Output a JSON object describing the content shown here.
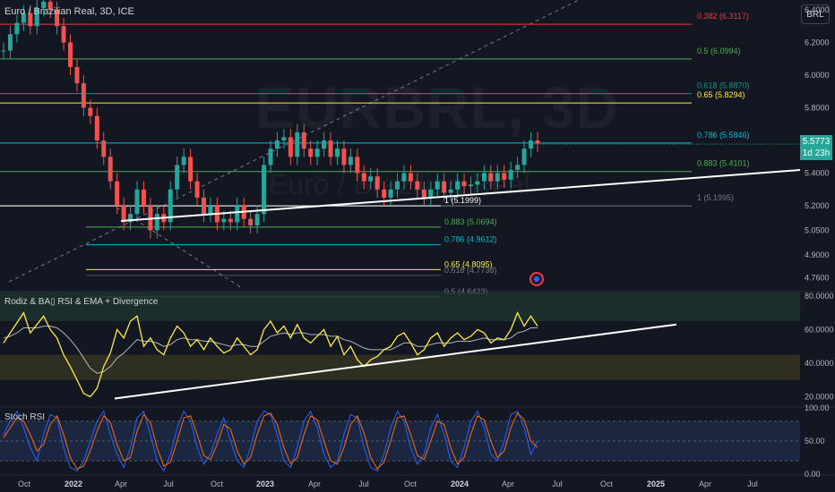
{
  "header": {
    "title": "Euro / Brazilian Real, 3D, ICE",
    "currency_button": "BRL",
    "watermark_symbol": "EURBRL, 3D",
    "watermark_name": "Euro / Brazilian Real"
  },
  "price_tag": {
    "value": "5.5773",
    "countdown": "1d 23h",
    "color": "#26a69a"
  },
  "chart_data": [
    {
      "type": "line",
      "pane": "price",
      "title": "Euro / Brazilian Real, 3D, ICE",
      "ylim": [
        4.68,
        6.46
      ],
      "y_ticks": [
        {
          "value": 6.4,
          "label": "6.4000"
        },
        {
          "value": 6.2,
          "label": "6.2000"
        },
        {
          "value": 6.0,
          "label": "6.0000"
        },
        {
          "value": 5.8,
          "label": "5.8000"
        },
        {
          "value": 5.6,
          "label": "5.6000"
        },
        {
          "value": 5.4,
          "label": "5.4000"
        },
        {
          "value": 5.2,
          "label": "5.2000"
        },
        {
          "value": 5.05,
          "label": "5.0500"
        },
        {
          "value": 4.9,
          "label": "4.9000"
        },
        {
          "value": 4.76,
          "label": "4.7600"
        }
      ],
      "x_ticks": [
        "Oct",
        "2022",
        "Apr",
        "Jul",
        "Oct",
        "2023",
        "Apr",
        "Jul",
        "Oct",
        "2024",
        "Apr",
        "Jul",
        "Oct",
        "2025",
        "Apr",
        "Jul"
      ],
      "fib_upper": [
        {
          "label": "0.382 (6.3117)",
          "value": 6.3117,
          "color": "#f23645"
        },
        {
          "label": "0.5 (6.0994)",
          "value": 6.0994,
          "color": "#4caf50"
        },
        {
          "label": "0.618 (5.8870)",
          "value": 5.887,
          "color": "#089981"
        },
        {
          "label": "0.65 (5.8294)",
          "value": 5.8294,
          "color": "#ffeb3b"
        },
        {
          "label": "0.786 (5.5846)",
          "value": 5.5846,
          "color": "#00bcd4"
        },
        {
          "label": "0.883 (5.4101)",
          "value": 5.4101,
          "color": "#4caf50"
        },
        {
          "label": "1 (5.1995)",
          "value": 5.1995,
          "color": "#787b86"
        }
      ],
      "fib_lower": [
        {
          "label": "1 (5.1999)",
          "value": 5.1999,
          "color": "#ffffff"
        },
        {
          "label": "0.883 (5.0694)",
          "value": 5.0694,
          "color": "#4caf50"
        },
        {
          "label": "0.786 (4.9612)",
          "value": 4.9612,
          "color": "#00bcd4"
        },
        {
          "label": "0.65 (4.8095)",
          "value": 4.8095,
          "color": "#ffeb3b"
        },
        {
          "label": "0.618 (4.7738)",
          "value": 4.7738,
          "color": "#787b86"
        },
        {
          "label": "0.5 (4.6423)",
          "value": 4.6423,
          "color": "#787b86"
        }
      ],
      "series": [
        {
          "close": [
            6.15,
            6.25,
            6.32,
            6.38,
            6.3,
            6.41,
            6.45,
            6.4,
            6.3,
            6.2,
            6.05,
            5.95,
            5.8,
            5.75,
            5.6,
            5.5,
            5.35,
            5.2,
            5.1,
            5.15,
            5.3,
            5.2,
            5.05,
            5.15,
            5.1,
            5.3,
            5.45,
            5.5,
            5.35,
            5.25,
            5.15,
            5.2,
            5.1,
            5.12,
            5.1,
            5.2,
            5.12,
            5.08,
            5.15,
            5.45,
            5.55,
            5.6,
            5.62,
            5.5,
            5.65,
            5.55,
            5.5,
            5.55,
            5.6,
            5.5,
            5.55,
            5.45,
            5.5,
            5.4,
            5.35,
            5.38,
            5.3,
            5.25,
            5.3,
            5.35,
            5.4,
            5.35,
            5.3,
            5.25,
            5.3,
            5.35,
            5.28,
            5.3,
            5.35,
            5.32,
            5.33,
            5.35,
            5.4,
            5.35,
            5.4,
            5.36,
            5.42,
            5.45,
            5.55,
            5.6,
            5.58
          ]
        }
      ],
      "up_color": "#26a69a",
      "down_color": "#ef5350"
    },
    {
      "type": "line",
      "pane": "rsi",
      "title": "Rodiz & BA▯ RSI & EMA + Divergence",
      "ylim": [
        15,
        82
      ],
      "y_ticks": [
        {
          "value": 80,
          "label": "80.0000"
        },
        {
          "value": 60,
          "label": "60.0000"
        },
        {
          "value": 40,
          "label": "40.0000"
        },
        {
          "value": 20,
          "label": "20.0000"
        }
      ],
      "series": [
        {
          "name": "RSI",
          "color": "#ffeb3b",
          "values": [
            52,
            58,
            64,
            70,
            58,
            63,
            68,
            60,
            55,
            45,
            38,
            30,
            22,
            20,
            25,
            38,
            46,
            60,
            55,
            65,
            68,
            50,
            55,
            48,
            45,
            55,
            62,
            58,
            50,
            54,
            48,
            55,
            50,
            46,
            48,
            55,
            50,
            45,
            48,
            60,
            65,
            58,
            62,
            55,
            63,
            55,
            52,
            56,
            60,
            50,
            56,
            45,
            50,
            42,
            38,
            42,
            44,
            48,
            50,
            56,
            58,
            52,
            45,
            48,
            55,
            58,
            50,
            55,
            58,
            54,
            56,
            60,
            58,
            52,
            55,
            54,
            60,
            70,
            62,
            68,
            62
          ]
        },
        {
          "name": "EMA",
          "color": "#b2b5be",
          "values": [
            55,
            56,
            58,
            61,
            61,
            61,
            62,
            62,
            61,
            58,
            54,
            49,
            43,
            37,
            34,
            35,
            38,
            43,
            46,
            50,
            54,
            53,
            53,
            52,
            50,
            51,
            54,
            55,
            54,
            54,
            53,
            53,
            52,
            51,
            50,
            51,
            51,
            50,
            50,
            53,
            56,
            57,
            58,
            57,
            58,
            58,
            57,
            57,
            57,
            56,
            56,
            54,
            53,
            51,
            49,
            48,
            48,
            48,
            48,
            50,
            52,
            52,
            50,
            50,
            51,
            52,
            52,
            52,
            53,
            53,
            53,
            54,
            55,
            54,
            54,
            54,
            55,
            58,
            59,
            61,
            61
          ]
        }
      ],
      "bands": [
        {
          "from": 65,
          "to": 82,
          "color": "#1e3b30"
        },
        {
          "from": 30,
          "to": 45,
          "color": "#3a3a22"
        }
      ]
    },
    {
      "type": "line",
      "pane": "stoch",
      "title": "Stoch RSI",
      "ylim": [
        0,
        100
      ],
      "y_ticks": [
        {
          "value": 100,
          "label": "100.00"
        },
        {
          "value": 50,
          "label": "50.00"
        },
        {
          "value": 0,
          "label": "0.00"
        }
      ],
      "series": [
        {
          "name": "K",
          "color": "#2962ff",
          "values": [
            60,
            80,
            95,
            70,
            40,
            20,
            60,
            90,
            85,
            40,
            10,
            5,
            20,
            50,
            80,
            95,
            60,
            30,
            10,
            40,
            85,
            95,
            60,
            20,
            5,
            30,
            70,
            95,
            80,
            40,
            15,
            30,
            60,
            85,
            50,
            20,
            10,
            40,
            80,
            95,
            90,
            60,
            20,
            10,
            40,
            80,
            95,
            70,
            30,
            10,
            20,
            60,
            90,
            85,
            40,
            10,
            5,
            30,
            70,
            95,
            80,
            40,
            15,
            30,
            70,
            90,
            60,
            20,
            10,
            40,
            80,
            95,
            70,
            30,
            20,
            50,
            90,
            95,
            70,
            30,
            50
          ]
        },
        {
          "name": "D",
          "color": "#ff6d00",
          "values": [
            55,
            70,
            85,
            80,
            60,
            35,
            45,
            75,
            88,
            60,
            25,
            8,
            12,
            35,
            65,
            88,
            78,
            45,
            20,
            25,
            65,
            90,
            78,
            40,
            12,
            18,
            50,
            85,
            88,
            60,
            28,
            22,
            45,
            75,
            68,
            35,
            15,
            25,
            60,
            88,
            92,
            75,
            40,
            15,
            25,
            60,
            88,
            82,
            50,
            20,
            15,
            40,
            75,
            88,
            62,
            25,
            8,
            18,
            50,
            85,
            88,
            60,
            28,
            22,
            50,
            80,
            75,
            40,
            15,
            25,
            60,
            88,
            82,
            50,
            25,
            35,
            70,
            92,
            82,
            50,
            40
          ]
        }
      ],
      "band": {
        "from": 20,
        "to": 80,
        "color": "#1e2a4a"
      }
    }
  ]
}
